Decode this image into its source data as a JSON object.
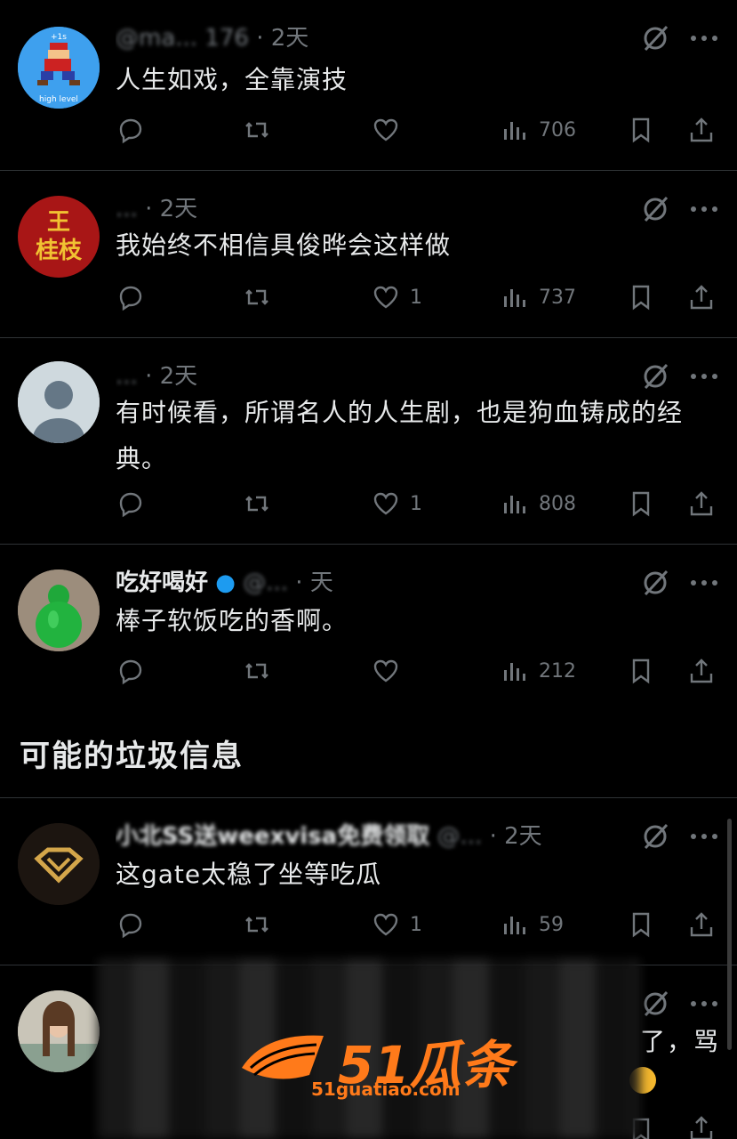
{
  "posts": [
    {
      "name": "",
      "handle": "@ma... 176",
      "time": "· 2天",
      "text": "人生如戏，全靠演技",
      "avatar_icon": "pixel-runner-avatar",
      "avatar_caption": "high level",
      "reply_count": "",
      "retweet_count": "",
      "like_count": "",
      "views": "706"
    },
    {
      "name": "",
      "handle": "...",
      "time": "· 2天",
      "text": "我始终不相信具俊晔会这样做",
      "avatar_icon": "seal-avatar",
      "avatar_text": "王\n桂枝",
      "reply_count": "",
      "retweet_count": "",
      "like_count": "1",
      "views": "737"
    },
    {
      "name": "",
      "handle": "...",
      "time": "· 2天",
      "text": "有时候看，所谓名人的人生剧，也是狗血铸成的经典。",
      "avatar_icon": "default-avatar",
      "reply_count": "",
      "retweet_count": "",
      "like_count": "1",
      "views": "808"
    },
    {
      "name": "吃好喝好",
      "handle": "@...",
      "time": "· 天",
      "text": "棒子软饭吃的香啊。",
      "avatar_icon": "jade-buddha-avatar",
      "reply_count": "",
      "retweet_count": "",
      "like_count": "",
      "views": "212"
    }
  ],
  "section_title": "可能的垃圾信息",
  "spam_posts": [
    {
      "name": "小北SS送weexvisa免费领取",
      "handle": "@...",
      "time": "· 2天",
      "text": "这gate太稳了坐等吃瓜",
      "avatar_icon": "gold-diamond-logo-avatar",
      "reply_count": "",
      "retweet_count": "",
      "like_count": "1",
      "views": "59"
    },
    {
      "name": "",
      "handle": "",
      "time": "",
      "text_visible_tail": "了，骂",
      "avatar_icon": "woman-photo-avatar"
    }
  ],
  "watermark": {
    "brand": "51瓜条",
    "url": "51guatiao.com"
  },
  "colors": {
    "background": "#000000",
    "text": "#e7e9ea",
    "muted": "#71767b",
    "divider": "#2f3336",
    "watermark": "#ff7a1a"
  }
}
